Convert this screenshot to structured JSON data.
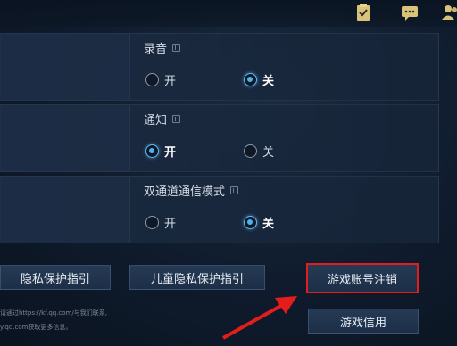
{
  "settings": [
    {
      "title": "录音",
      "options": [
        {
          "label": "开",
          "selected": false
        },
        {
          "label": "关",
          "selected": true
        }
      ]
    },
    {
      "title": "通知",
      "options": [
        {
          "label": "开",
          "selected": true
        },
        {
          "label": "关",
          "selected": false
        }
      ]
    },
    {
      "title": "双通道通信模式",
      "options": [
        {
          "label": "开",
          "selected": false
        },
        {
          "label": "关",
          "selected": true
        }
      ]
    }
  ],
  "buttons": {
    "privacy_guide": "隐私保护指引",
    "child_privacy_guide": "儿童隐私保护指引",
    "account_cancel": "游戏账号注销",
    "game_credit": "游戏信用"
  },
  "footnote": {
    "line1": "请通过https://kf.qq.com/与我们联系,",
    "line2": "y.qq.com获取更多信息。"
  },
  "icons": [
    "checklist-icon",
    "chat-icon",
    "friends-icon",
    "info-icon"
  ],
  "colors": {
    "highlight": "#e51c1c",
    "radio_active": "#4fb0ee"
  }
}
